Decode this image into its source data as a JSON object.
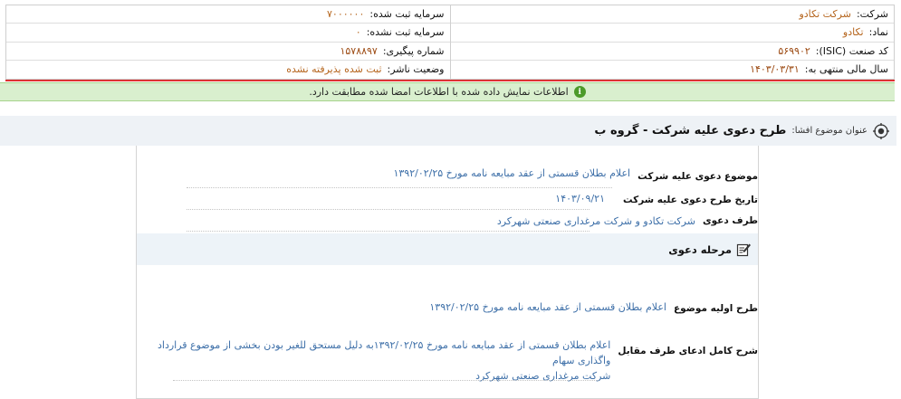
{
  "company_info": {
    "company_label": "شرکت:",
    "company_value": "شرکت تکادو",
    "symbol_label": "نماد:",
    "symbol_value": "تکادو",
    "isic_label": "کد صنعت (ISIC):",
    "isic_value": "۵۶۹۹۰۲",
    "fiscal_label": "سال مالی منتهی به:",
    "fiscal_value": "۱۴۰۳/۰۳/۳۱",
    "reg_capital_label": "سرمایه ثبت شده:",
    "reg_capital_value": "۷۰۰۰۰۰۰",
    "unreg_capital_label": "سرمایه ثبت نشده:",
    "unreg_capital_value": "۰",
    "tracking_label": "شماره پیگیری:",
    "tracking_value": "۱۵۷۸۸۹۷",
    "publisher_status_label": "وضعیت ناشر:",
    "publisher_status_value": "ثبت شده پذیرفته نشده"
  },
  "notice": {
    "text": "اطلاعات نمایش داده شده با اطلاعات امضا شده مطابقت دارد."
  },
  "subject": {
    "label": "عنوان موضوع افشا:",
    "value": "طرح دعوی علیه شرکت - گروه ب"
  },
  "fields": {
    "claim_subject_label": "موضوع دعوی علیه شرکت",
    "claim_subject_value": "اعلام بطلان قسمتی از عقد مبایعه نامه مورخ ۱۳۹۲/۰۲/۲۵",
    "claim_date_label": "تاریخ طرح دعوی علیه شرکت",
    "claim_date_value": "۱۴۰۳/۰۹/۲۱",
    "claim_party_label": "طرف دعوی",
    "claim_party_value": "شرکت تکادو و شرکت مرغداری صنعتی شهرکرد"
  },
  "stage": {
    "title": "مرحله دعوی",
    "initial_label": "طرح اولیه موضوع",
    "initial_value": "اعلام بطلان قسمتی از عقد مبایعه نامه مورخ ۱۳۹۲/۰۲/۲۵",
    "full_label": "شرح کامل ادعای طرف مقابل",
    "full_value_line1": "اعلام بطلان قسمتی از عقد مبایعه نامه مورخ ۱۳۹۲/۰۲/۲۵به دلیل مستحق للغیر بودن بخشی از موضوع قرارداد واگذاری سهام",
    "full_value_line2": "شرکت مرغداری صنعتی شهرکرد"
  },
  "colors": {
    "value_orange": "#b5651d",
    "value_blue": "#3d6fa8",
    "notice_green": "#d9efce",
    "header_red": "#dd3333"
  }
}
